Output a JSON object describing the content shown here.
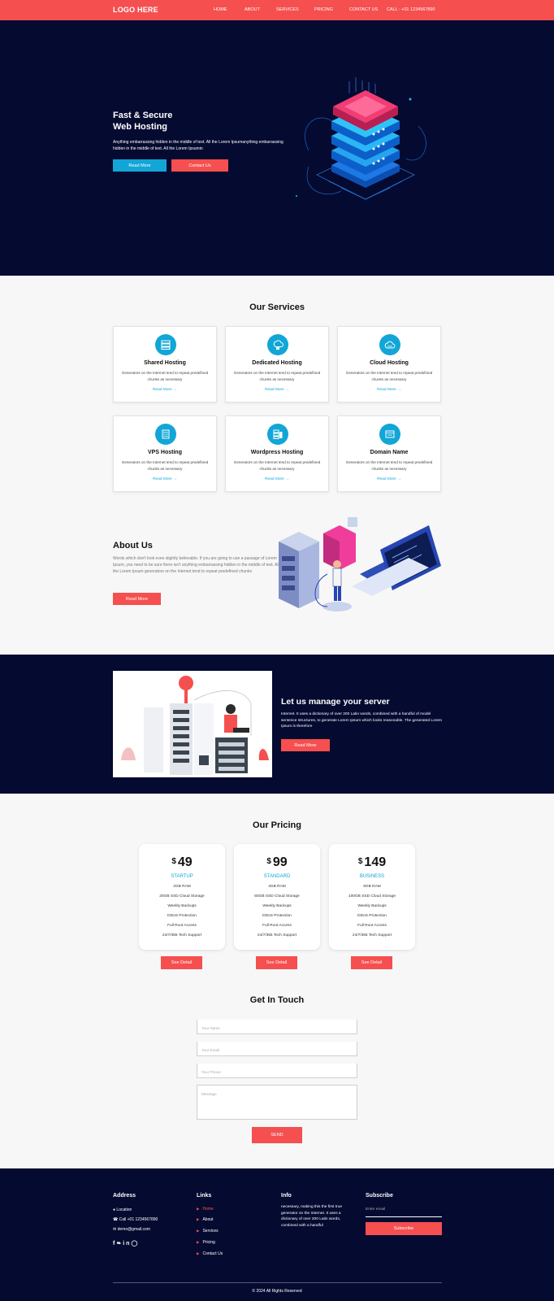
{
  "colors": {
    "accent": "#f54f4f",
    "blue": "#11a6d6",
    "navy": "#050a30"
  },
  "nav": {
    "logo": "LOGO HERE",
    "items": [
      "HOME",
      "ABOUT",
      "SERVICES",
      "PRICING",
      "CONTACT US",
      "CALL : +01 1234567890"
    ]
  },
  "hero": {
    "title_line1": "Fast & Secure",
    "title_line2": "Web Hosting",
    "text": "Anything embarrassing hidden in the middle of text. All the Lorem Ipsumanything embarrassing hidden in the middle of text. All the Lorem Ipsumin",
    "read_more": "Read More",
    "contact_us": "Contact Us"
  },
  "services": {
    "title": "Our Services",
    "items": [
      {
        "title": "Shared Hosting",
        "text": "Generators on the Internet tend to repeat predefined chunks as necessary",
        "link": "Read More →",
        "icon": "shared-hosting-icon"
      },
      {
        "title": "Dedicated Hosting",
        "text": "Generators on the Internet tend to repeat predefined chunks as necessary",
        "link": "Read More →",
        "icon": "dedicated-hosting-icon"
      },
      {
        "title": "Cloud Hosting",
        "text": "Generators on the Internet tend to repeat predefined chunks as necessary",
        "link": "Read More →",
        "icon": "cloud-hosting-icon"
      },
      {
        "title": "VPS Hosting",
        "text": "Generators on the Internet tend to repeat predefined chunks as necessary",
        "link": "Read More →",
        "icon": "vps-hosting-icon"
      },
      {
        "title": "Wordpress Hosting",
        "text": "Generators on the Internet tend to repeat predefined chunks as necessary",
        "link": "Read More →",
        "icon": "wordpress-hosting-icon"
      },
      {
        "title": "Domain Name",
        "text": "Generators on the Internet tend to repeat predefined chunks as necessary",
        "link": "Read More →",
        "icon": "domain-name-icon"
      }
    ]
  },
  "about": {
    "title": "About Us",
    "text": "Words which don't look even slightly believable. If you are going to use a passage of Lorem Ipsum, you need to be sure there isn't anything embarrassing hidden in the middle of text. All the Lorem Ipsum generators on the Internet tend to repeat predefined chunks",
    "button": "Read More"
  },
  "manage": {
    "title": "Let us manage your server",
    "text": "Internet. It uses a dictionary of over 200 Latin words, combined with a handful of model sentence structures, to generate Lorem Ipsum which looks reasonable. The generated Lorem Ipsum is therefore",
    "button": "Read More"
  },
  "pricing": {
    "title": "Our Pricing",
    "currency": "$",
    "plans": [
      {
        "price": "49",
        "name": "STARTUP",
        "features": [
          "2GB RAM",
          "20GB SSD Cloud Storage",
          "Weekly Backups",
          "DDoS Protection",
          "Full Root Access",
          "24/7/365 Tech Support"
        ],
        "button": "See Detail"
      },
      {
        "price": "99",
        "name": "STANDARD",
        "features": [
          "4GB RAM",
          "50GB SSD Cloud Storage",
          "Weekly Backups",
          "DDoS Protection",
          "Full Root Access",
          "24/7/365 Tech Support"
        ],
        "button": "See Detail"
      },
      {
        "price": "149",
        "name": "BUSINESS",
        "features": [
          "8GB RAM",
          "100GB SSD Cloud Storage",
          "Weekly Backups",
          "DDoS Protection",
          "Full Root Access",
          "24/7/365 Tech Support"
        ],
        "button": "See Detail"
      }
    ]
  },
  "contact": {
    "title": "Get In Touch",
    "name_placeholder": "Your Name",
    "email_placeholder": "Your Email",
    "phone_placeholder": "Your Phone",
    "message_placeholder": "Message",
    "send": "SEND"
  },
  "footer": {
    "address_title": "Address",
    "location": "Location",
    "phone": "Call +01 1234567890",
    "email": "demo@gmail.com",
    "links_title": "Links",
    "links": [
      "Home",
      "About",
      "Services",
      "Pricing",
      "Contact Us"
    ],
    "info_title": "Info",
    "info_text": "necessary, making this the first true generator on the Internet. It uses a dictionary of over 200 Latin words, combined with a handful",
    "subscribe_title": "Subscribe",
    "email_placeholder": "Enter email",
    "subscribe_button": "Subscribe",
    "copyright": "© 2024 All Rights Reserved"
  }
}
